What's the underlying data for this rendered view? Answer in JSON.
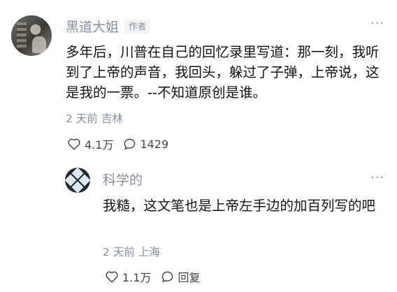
{
  "comment": {
    "author": "黑道大姐",
    "badge": "作者",
    "text": "多年后，川普在自己的回忆录里写道：那一刻，我听到了上帝的声音，我回头，躲过了子弹，上帝说，这是我的一票。--不知道原创是谁。",
    "time": "2 天前",
    "location": "吉林",
    "likes": "4.1万",
    "replies": "1429"
  },
  "reply": {
    "author": "科学的",
    "text": "我糙，这文笔也是上帝左手边的加百列写的吧",
    "time": "2 天前",
    "location": "上海",
    "likes": "1.1万",
    "reply_label": "回复"
  },
  "icons": {
    "like": "heart-icon",
    "comment": "comment-bubble-icon",
    "more": "more-dots-icon"
  },
  "colors": {
    "meta": "#8590a6",
    "text": "#121212"
  }
}
